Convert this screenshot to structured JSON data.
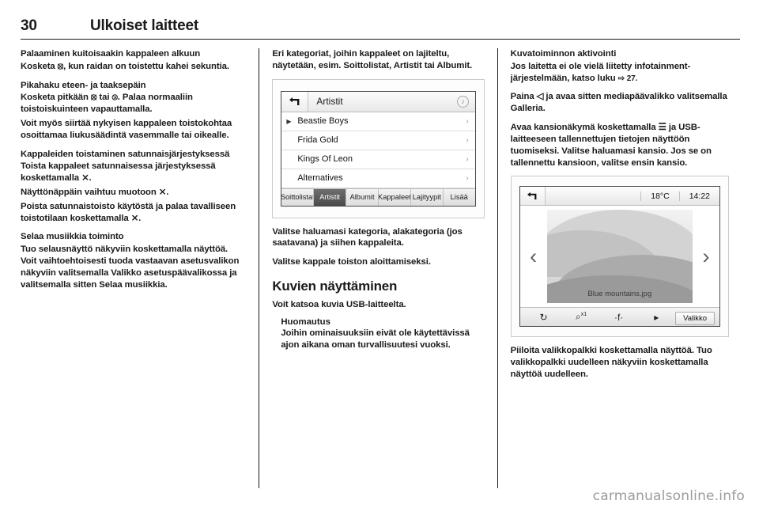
{
  "header": {
    "page_number": "30",
    "chapter_title": "Ulkoiset laitteet"
  },
  "column1": {
    "section1_heading_line1": "Palaaminen kuitoisaakin kappaleen",
    "section1_heading": "Palaaminen kuitoisaakin kappaleen alkuun",
    "section1_body": "Kosketa ⦻, kun raidan on toistettu kahei sekuntia.",
    "section2_heading": "Pikahaku eteen- ja taaksepäin",
    "section2_body1": "Kosketa pitkään ⦻ tai ⦼. Palaa normaaliin toistoiskuinteen vapauttamalla.",
    "section2_body2": "Voit myös siirtää nykyisen kappaleen toistokohtaa osoittamaa liukusäädintä vasemmalle tai oikealle.",
    "section3_heading": "Kappaleiden toistaminen satunnaisjärjestyksessä",
    "section3_body1": "Toista kappaleet satunnaisessa järjestyksessä koskettamalla ⨯.",
    "section3_body2": "Näyttönäppäin vaihtuu muotoon ⨯.",
    "section3_body3": "Poista satunnaistoisto käytöstä ja palaa tavalliseen toistotilaan koskettamalla ⨯.",
    "section4_heading": "Selaa musiikkia toiminto",
    "section4_body": "Tuo selausnäyttö näkyviin koskettamalla näyttöä. Voit vaihtoehtoisesti tuoda vastaavan asetusvalikon näkyviin valitsemalla Valikko asetuspäävalikossa ja valitsemalla sitten Selaa musiikkia."
  },
  "column2": {
    "intro": "Eri kategoriat, joihin kappaleet on lajiteltu, näytetään, esim. Soittolistat, Artistit tai Albumit.",
    "body1": "Valitse haluamasi kategoria, alakategoria (jos saatavana) ja siihen kappaleita.",
    "body2": "Valitse kappale toiston aloittamiseksi.",
    "section_heading": "Kuvien näyttäminen",
    "body3": "Voit katsoa kuvia USB-laitteelta.",
    "note_title": "Huomautus",
    "note_body": "Joihin ominaisuuksiin eivät ole käytettävissä ajon aikana oman turvallisuutesi vuoksi."
  },
  "column3": {
    "section_heading": "Kuvatoiminnon aktivointi",
    "body1": "Jos laitetta ei ole vielä liitetty infotainment-järjestelmään, katso luku",
    "body1_ref": "⇨ 27.",
    "body2": "Paina ◁ ja avaa sitten mediapäävalikko valitsemalla Galleria.",
    "body3": "Avaa kansionäkymä koskettamalla ☰ ja USB-laitteeseen tallennettujen tietojen näyttöön tuomiseksi. Valitse haluamasi kansio. Jos se on tallennettu kansioon, valitse ensin kansio.",
    "body4": "Piiloita valikkopalkki koskettamalla näyttöä. Tuo valikkopalkki uudelleen näkyviin koskettamalla näyttöä uudelleen."
  },
  "shot1": {
    "back_icon": "back-arrow-icon",
    "title": "Artistit",
    "note_icon": "♪",
    "rows": [
      {
        "marker": "▶",
        "label": "Beastie Boys",
        "chevron": "›"
      },
      {
        "marker": "",
        "label": "Frida Gold",
        "chevron": "›"
      },
      {
        "marker": "",
        "label": "Kings Of Leon",
        "chevron": "›"
      },
      {
        "marker": "",
        "label": "Alternatives",
        "chevron": "›"
      }
    ],
    "tabs": [
      {
        "label": "Soittolistat",
        "active": false
      },
      {
        "label": "Artistit",
        "active": true
      },
      {
        "label": "Albumit",
        "active": false
      },
      {
        "label": "Kappaleet",
        "active": false
      },
      {
        "label": "Lajityypit",
        "active": false
      },
      {
        "label": "Lisää",
        "active": false
      }
    ]
  },
  "shot2": {
    "back_icon": "back-arrow-icon",
    "temperature": "18°C",
    "time": "14:22",
    "prev_arrow": "‹",
    "next_arrow": "›",
    "photo_caption": "Blue mountains.jpg",
    "toolbar": [
      {
        "name": "rotate-icon",
        "glyph": "↻",
        "sup": ""
      },
      {
        "name": "zoom-icon",
        "glyph": "⌕",
        "sup": "x1"
      },
      {
        "name": "settings-icon",
        "glyph": "·f·",
        "sup": ""
      },
      {
        "name": "slideshow-icon",
        "glyph": "▸",
        "sup": ""
      }
    ],
    "menu_label": "Valikko"
  },
  "watermark": "carmanualsonline.info"
}
